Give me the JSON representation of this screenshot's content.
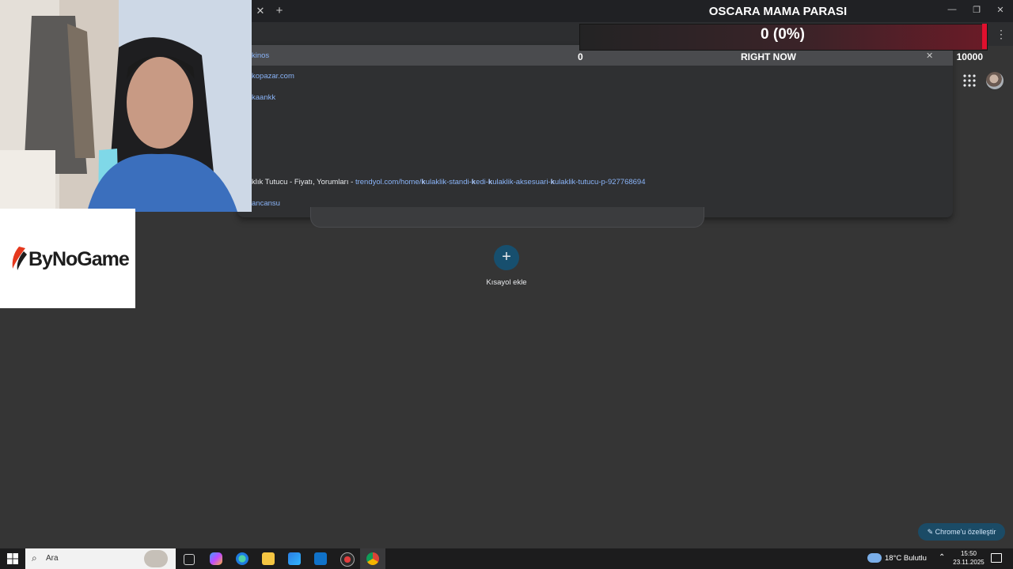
{
  "chrome": {
    "tab_close": "✕",
    "new_tab": "+",
    "window_controls": {
      "minimize": "—",
      "restore": "❐",
      "close": "✕"
    },
    "menu": "⋮",
    "icons": {
      "apps": "grid-icon",
      "profile": "avatar-icon",
      "customize": "pencil-icon"
    }
  },
  "omnibox_dropdown": {
    "suggestions": [
      {
        "url": "kinos"
      },
      {
        "url": "kopazar.com"
      },
      {
        "url": "kaankk"
      },
      {
        "text": "klık Tutucu - Fiyatı, Yorumları",
        "sep": " - ",
        "url_parts": [
          "trendyol.com/home/",
          "k",
          "ulaklik-standi-",
          "k",
          "edi-",
          "k",
          "ulaklik-aksesuari-",
          "k",
          "ulaklik-tutucu-p-927768694"
        ]
      },
      {
        "url": "ancansu"
      }
    ]
  },
  "new_tab_page": {
    "add_shortcut_icon": "+",
    "add_shortcut_label": "Kısayol ekle",
    "customize_label": "Chrome'u özelleştir"
  },
  "goal_widget": {
    "title": "OSCARA MAMA PARASI",
    "amount": "0 (0%)",
    "progress_fraction": 0.0,
    "min": "0",
    "label": "RIGHT NOW",
    "max": "10000",
    "close": "✕",
    "colors": {
      "bar_end": "#e0102e",
      "bar_mid": "#6a1b27"
    }
  },
  "brand": {
    "name": "ByNoGame"
  },
  "taskbar": {
    "search_label": "Ara",
    "weather": "18°C  Bulutlu",
    "time": "15:50",
    "date": "23.11.2025",
    "icons": [
      "windows-start-icon",
      "search-icon",
      "task-view-icon",
      "copilot-icon",
      "edge-icon",
      "file-explorer-icon",
      "store-icon",
      "outlook-icon",
      "recorder-icon",
      "chrome-icon"
    ]
  }
}
